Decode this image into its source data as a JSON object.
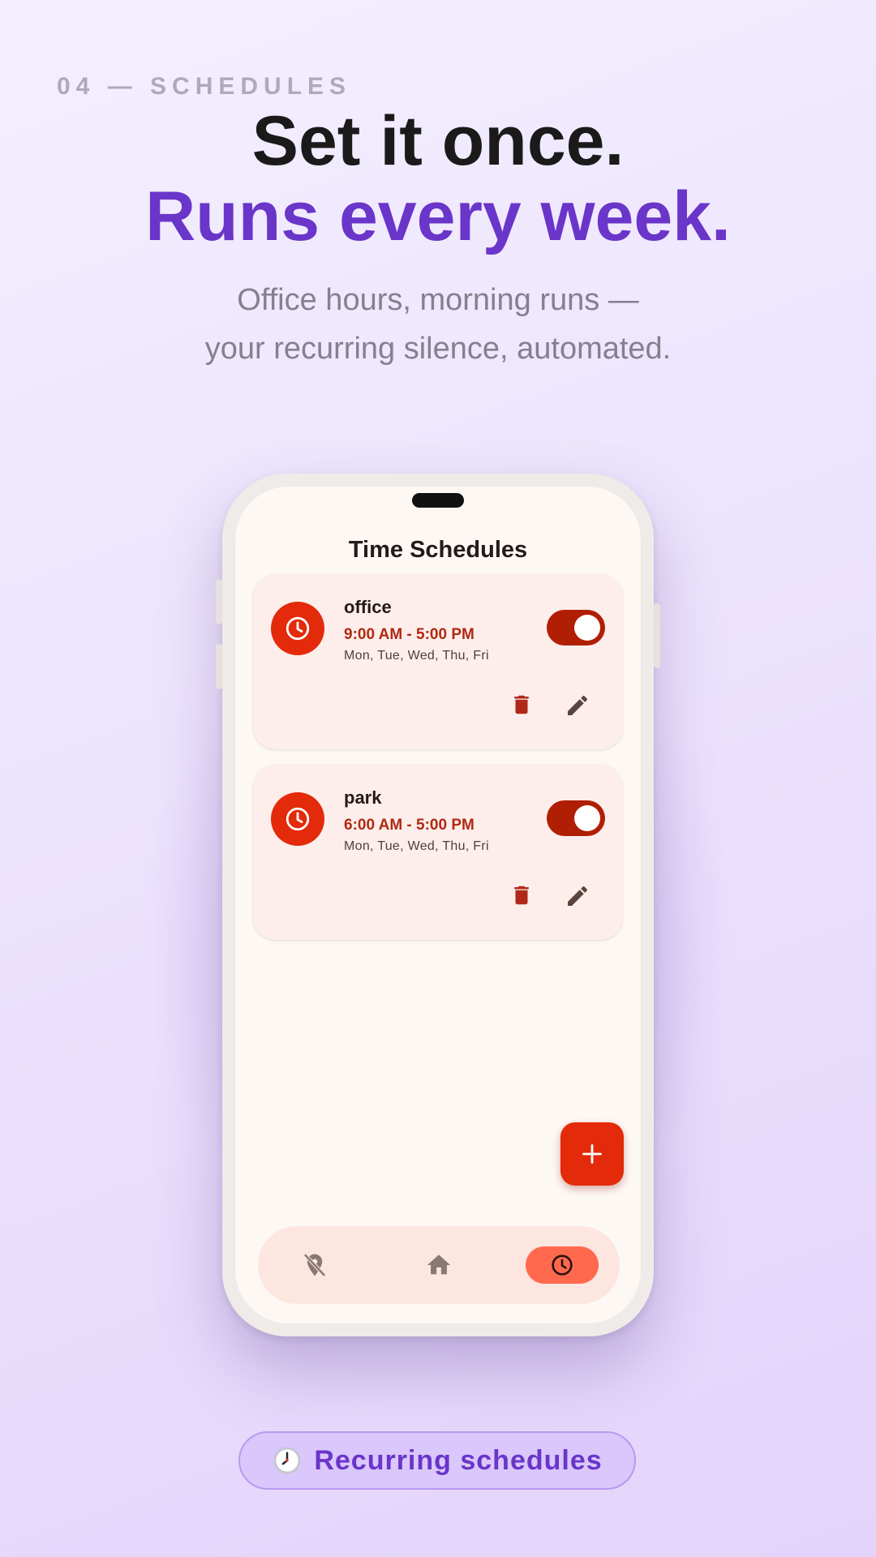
{
  "header": {
    "eyebrow": "04 — SCHEDULES",
    "headline_1": "Set it once.",
    "headline_2": "Runs every week.",
    "sub_line_1": "Office hours, morning runs —",
    "sub_line_2": "your recurring silence, automated."
  },
  "app": {
    "title": "Time Schedules",
    "schedules": [
      {
        "name": "office",
        "time": "9:00 AM - 5:00 PM",
        "days": "Mon, Tue, Wed, Thu, Fri",
        "enabled": true
      },
      {
        "name": "park",
        "time": "6:00 AM - 5:00 PM",
        "days": "Mon, Tue, Wed, Thu, Fri",
        "enabled": true
      }
    ],
    "fab_icon": "plus-icon",
    "nav": [
      {
        "icon": "location-off-icon",
        "active": false
      },
      {
        "icon": "home-icon",
        "active": false
      },
      {
        "icon": "clock-icon",
        "active": true
      }
    ]
  },
  "chip": {
    "icon": "clock-emoji-icon",
    "label": "Recurring schedules"
  },
  "colors": {
    "accent_purple": "#6a35c9",
    "app_red": "#e32a0a",
    "toggle_on": "#b01e04",
    "card_bg": "#fdeeeb"
  }
}
